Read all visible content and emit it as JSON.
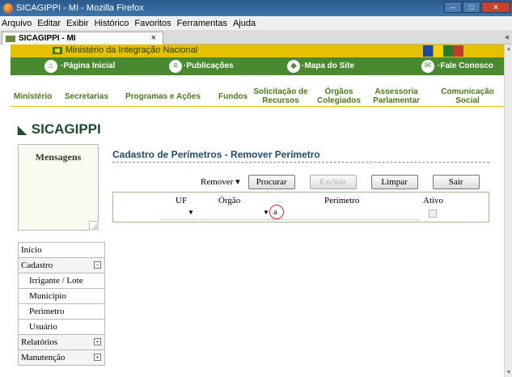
{
  "window": {
    "title": "SICAGIPPI - MI - Mozilla Firefox"
  },
  "menubar": {
    "items": [
      "Arquivo",
      "Editar",
      "Exibir",
      "Histórico",
      "Favoritos",
      "Ferramentas",
      "Ajuda"
    ]
  },
  "tab": {
    "label": "SICAGIPPI - MI",
    "close": "×"
  },
  "site": {
    "ministry": "Ministério da Integração Nacional",
    "nav": [
      "·Página Inicial",
      "·Publicações",
      "·Mapa do Site",
      "·Fale Conosco"
    ],
    "mainnav": [
      "Ministério",
      "Secretarias",
      "Programas e Ações",
      "Fundos",
      "Solicitação de Recursos",
      "Órgãos Colegiados",
      "Assessoria Parlamentar",
      "Comunicação Social"
    ]
  },
  "brand": {
    "name": "SICAGIPPI"
  },
  "messages": {
    "title": "Mensagens"
  },
  "sidebar": {
    "items": [
      {
        "label": "Início"
      },
      {
        "label": "Cadastro",
        "toggle": "−"
      },
      {
        "label": "Irrigante / Lote"
      },
      {
        "label": "Município"
      },
      {
        "label": "Perímetro"
      },
      {
        "label": "Usuário"
      },
      {
        "label": "Relatórios",
        "toggle": "+"
      },
      {
        "label": "Manutenção",
        "toggle": "+"
      }
    ]
  },
  "form": {
    "title": "Cadastro de Perímetros - Remover Perímetro",
    "mode": "Remover ▾",
    "buttons": {
      "search": "Procurar",
      "delete": "Excluir",
      "clear": "Limpar",
      "exit": "Sair"
    },
    "labels": {
      "uf": "UF",
      "orgao": "Órgão",
      "perimetro": "Perímetro",
      "ativo": "Ativo"
    },
    "perimetro_value": "a"
  }
}
